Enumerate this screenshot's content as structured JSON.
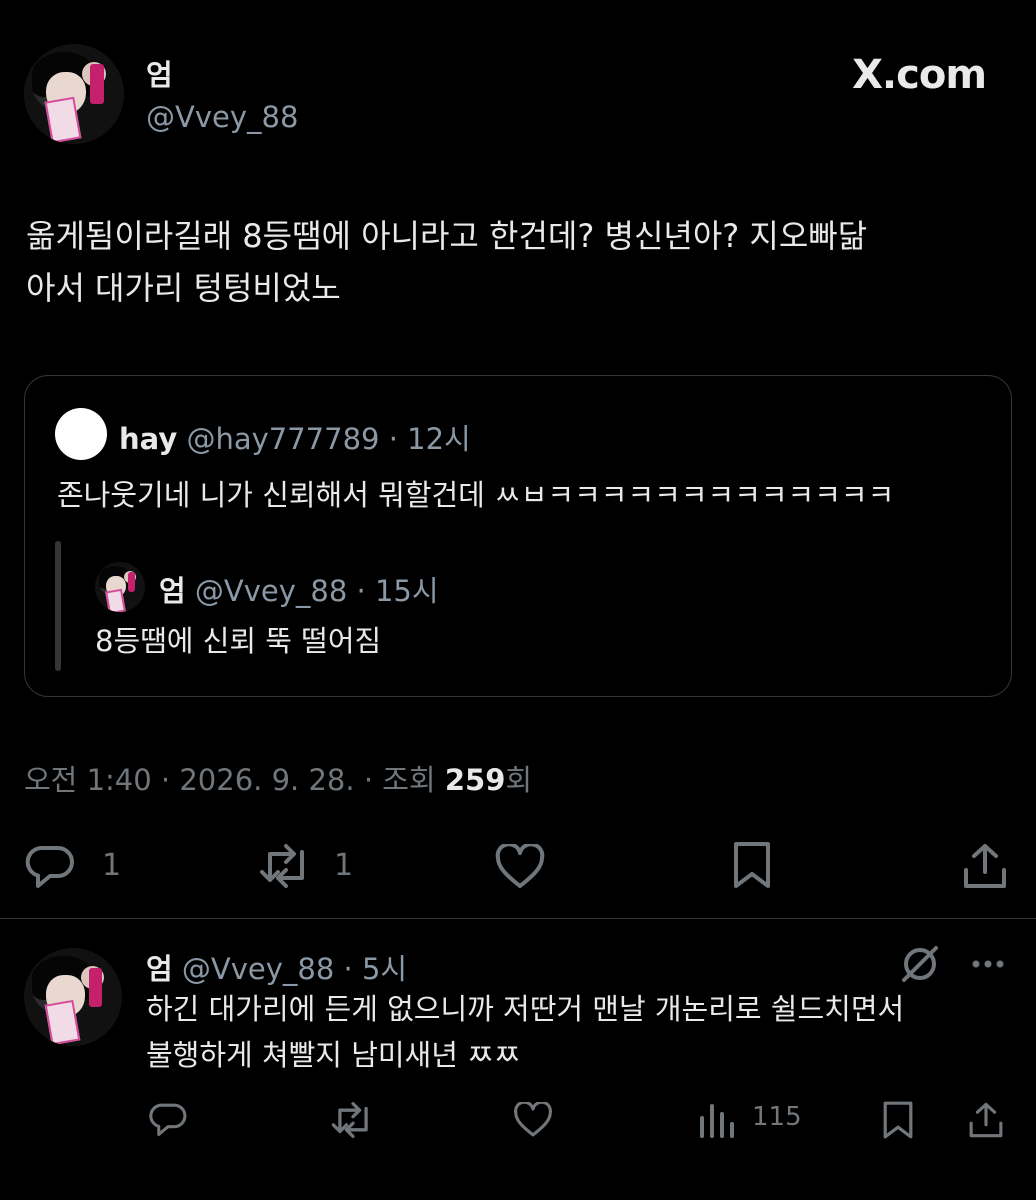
{
  "site": {
    "logo": "X.com"
  },
  "main_tweet": {
    "author_name": "엄",
    "author_handle": "@Vvey_88",
    "text": "옮게됨이라길래 8등땜에 아니라고 한건데? 병신년아? 지오빠닮아서 대가리 텅텅비었노",
    "text_line1": "옮게됨이라길래 8등땜에 아니라고 한건데? 병신년아? 지오빠닮",
    "text_line2": "아서 대가리 텅텅비었노",
    "meta_prefix": "오전 1:40 · 2026. 9. 28. · 조회 ",
    "views": "259",
    "views_suffix": "회",
    "actions": {
      "reply_count": "1",
      "retweet_count": "1"
    }
  },
  "quoted_tweet": {
    "author_name": "hay",
    "author_handle": "@hay777789",
    "time": "· 12시",
    "text": "존나웃기네 니가 신뢰해서 뭐할건데 ㅆㅂㅋㅋㅋㅋㅋㅋㅋㅋㅋㅋㅋㅋㅋ",
    "nested": {
      "author_name": "엄",
      "author_handle": "@Vvey_88",
      "time": "· 15시",
      "text": "8등땜에 신뢰 뚝 떨어짐"
    }
  },
  "reply_tweet": {
    "author_name": "엄",
    "author_handle": "@Vvey_88",
    "time": "· 5시",
    "text_line1": "하긴 대가리에 든게 없으니까 저딴거 맨날 개논리로 쉴드치면서",
    "text_line2": "불행하게 쳐빨지 남미새년 ㅉㅉ",
    "views": "115"
  },
  "icons": [
    "reply-icon",
    "retweet-icon",
    "like-icon",
    "bookmark-icon",
    "share-icon",
    "grok-icon",
    "more-icon",
    "views-icon"
  ],
  "colors": {
    "background": "#000000",
    "text": "#e7e9ea",
    "muted": "#71767b",
    "border": "#333639"
  }
}
